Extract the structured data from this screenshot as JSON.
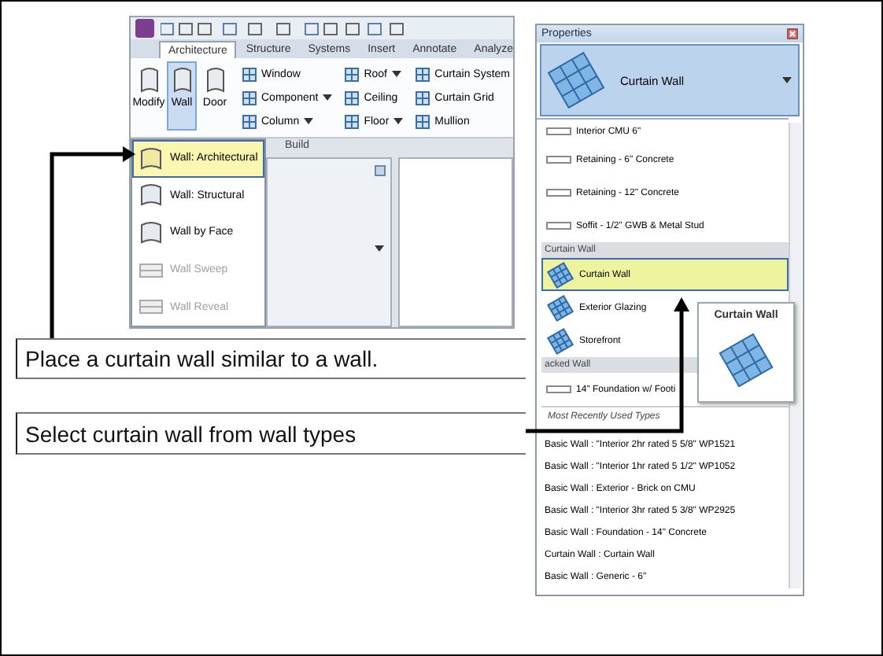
{
  "ribbon_screenshot": {
    "tabs": [
      {
        "label": "Architecture",
        "selected": true
      },
      {
        "label": "Structure",
        "selected": false
      },
      {
        "label": "Systems",
        "selected": false
      },
      {
        "label": "Insert",
        "selected": false
      },
      {
        "label": "Annotate",
        "selected": false
      },
      {
        "label": "Analyze",
        "selected": false
      }
    ],
    "large_buttons": [
      {
        "label": "Modify",
        "selected": false
      },
      {
        "label": "Wall",
        "selected": true
      },
      {
        "label": "Door",
        "selected": false
      }
    ],
    "small_button_columns": [
      [
        {
          "label": "Window",
          "dropdown": false
        },
        {
          "label": "Component",
          "dropdown": true
        },
        {
          "label": "Column",
          "dropdown": true
        }
      ],
      [
        {
          "label": "Roof",
          "dropdown": true
        },
        {
          "label": "Ceiling",
          "dropdown": false
        },
        {
          "label": "Floor",
          "dropdown": true
        }
      ],
      [
        {
          "label": "Curtain System",
          "dropdown": false
        },
        {
          "label": "Curtain Grid",
          "dropdown": false
        },
        {
          "label": "Mullion",
          "dropdown": false
        }
      ]
    ],
    "panel_label": "Build",
    "wall_menu": [
      {
        "label": "Wall: Architectural",
        "selected": true,
        "disabled": false
      },
      {
        "label": "Wall: Structural",
        "selected": false,
        "disabled": false
      },
      {
        "label": "Wall by Face",
        "selected": false,
        "disabled": false
      },
      {
        "label": "Wall Sweep",
        "selected": false,
        "disabled": true
      },
      {
        "label": "Wall Reveal",
        "selected": false,
        "disabled": true
      }
    ]
  },
  "callouts": [
    {
      "text": "Place a curtain wall similar to a wall."
    },
    {
      "text": "Select curtain wall from wall types"
    }
  ],
  "properties_screenshot": {
    "title": "Properties",
    "type_selector": "Curtain Wall",
    "type_list": [
      {
        "kind": "line",
        "label": "Interior CMU 6\"",
        "selected": false
      },
      {
        "kind": "line",
        "label": "Retaining - 6\" Concrete",
        "selected": false
      },
      {
        "kind": "line",
        "label": "Retaining - 12\" Concrete",
        "selected": false
      },
      {
        "kind": "line",
        "label": "Soffit - 1/2\" GWB & Metal Stud",
        "selected": false
      },
      {
        "kind": "group",
        "label": "Curtain Wall"
      },
      {
        "kind": "grid",
        "label": "Curtain Wall",
        "selected": true
      },
      {
        "kind": "grid",
        "label": "Exterior Glazing",
        "selected": false
      },
      {
        "kind": "grid",
        "label": "Storefront",
        "selected": false
      },
      {
        "kind": "group",
        "label": "acked Wall"
      },
      {
        "kind": "line",
        "label": "14\" Foundation w/ Footi",
        "selected": false
      }
    ],
    "mru_header": "Most Recently Used Types",
    "mru_items": [
      "Basic Wall : \"Interior 2hr rated  5 5/8\"  WP1521",
      "Basic Wall : \"Interior 1hr rated  5 1/2\"  WP1052",
      "Basic Wall : Exterior - Brick on CMU",
      "Basic Wall : \"Interior 3hr rated  5 3/8\"  WP2925",
      "Basic Wall : Foundation - 14\" Concrete",
      "Curtain Wall : Curtain Wall",
      "Basic Wall : Generic - 6\""
    ],
    "tooltip": {
      "title": "Curtain Wall"
    }
  }
}
